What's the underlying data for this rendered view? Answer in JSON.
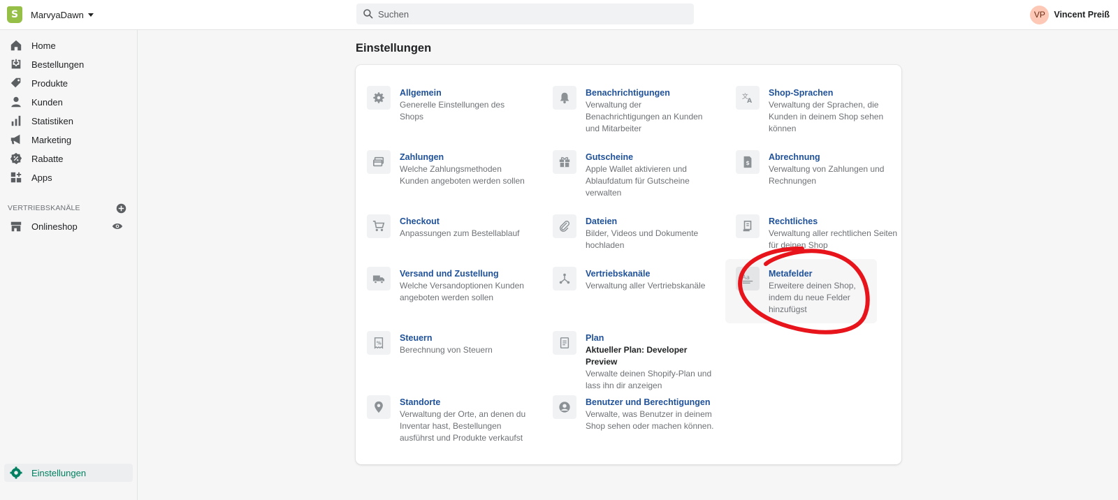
{
  "topbar": {
    "store_name": "MarvyaDawn",
    "search_placeholder": "Suchen",
    "user_initials": "VP",
    "user_name": "Vincent Preiß"
  },
  "sidebar": {
    "items": [
      {
        "label": "Home",
        "icon": "home-icon"
      },
      {
        "label": "Bestellungen",
        "icon": "orders-icon"
      },
      {
        "label": "Produkte",
        "icon": "tag-icon"
      },
      {
        "label": "Kunden",
        "icon": "person-icon"
      },
      {
        "label": "Statistiken",
        "icon": "bar-chart-icon"
      },
      {
        "label": "Marketing",
        "icon": "megaphone-icon"
      },
      {
        "label": "Rabatte",
        "icon": "discount-icon"
      },
      {
        "label": "Apps",
        "icon": "apps-icon"
      }
    ],
    "sales_channels_label": "VERTRIEBSKANÄLE",
    "onlineshop_label": "Onlineshop",
    "settings_label": "Einstellungen"
  },
  "page": {
    "title": "Einstellungen"
  },
  "settings": [
    {
      "title": "Allgemein",
      "desc": "Generelle Einstellungen des Shops",
      "icon": "gear-icon"
    },
    {
      "title": "Benachrichtigungen",
      "desc": "Verwaltung der Benachrichtigungen an Kunden und Mitarbeiter",
      "icon": "bell-icon"
    },
    {
      "title": "Shop-Sprachen",
      "desc": "Verwaltung der Sprachen, die Kunden in deinem Shop sehen können",
      "icon": "translate-icon"
    },
    {
      "title": "Zahlungen",
      "desc": "Welche Zahlungsmethoden Kunden angeboten werden sollen",
      "icon": "payment-icon"
    },
    {
      "title": "Gutscheine",
      "desc": "Apple Wallet aktivieren und Ablaufdatum für Gutscheine verwalten",
      "icon": "gift-icon"
    },
    {
      "title": "Abrechnung",
      "desc": "Verwaltung von Zahlungen und Rechnungen",
      "icon": "billing-icon"
    },
    {
      "title": "Checkout",
      "desc": "Anpassungen zum Bestellablauf",
      "icon": "cart-icon"
    },
    {
      "title": "Dateien",
      "desc": "Bilder, Videos und Dokumente hochladen",
      "icon": "paperclip-icon"
    },
    {
      "title": "Rechtliches",
      "desc": "Verwaltung aller rechtlichen Seiten für deinen Shop",
      "icon": "legal-icon"
    },
    {
      "title": "Versand und Zustellung",
      "desc": "Welche Versandoptionen Kunden angeboten werden sollen",
      "icon": "truck-icon"
    },
    {
      "title": "Vertriebskanäle",
      "desc": "Verwaltung aller Vertriebskanäle",
      "icon": "channels-icon"
    },
    {
      "title": "Metafelder",
      "desc": "Erweitere deinen Shop, indem du neue Felder hinzufügst",
      "icon": "metafields-icon"
    },
    {
      "title": "Steuern",
      "desc": "Berechnung von Steuern",
      "icon": "tax-icon"
    },
    {
      "title": "Plan",
      "subtitle": "Aktueller Plan: Developer Preview",
      "desc": "Verwalte deinen Shopify-Plan und lass ihn dir anzeigen",
      "icon": "plan-icon"
    },
    {
      "title": "Standorte",
      "desc": "Verwaltung der Orte, an denen du Inventar hast, Bestellungen ausführst und Produkte verkaufst",
      "icon": "location-icon"
    },
    {
      "title": "Benutzer und Berechtigungen",
      "desc": "Verwalte, was Benutzer in deinem Shop sehen oder machen können.",
      "icon": "user-circle-icon"
    }
  ],
  "colors": {
    "link": "#1f5199",
    "active_nav": "#008060",
    "annotation": "#e8141b",
    "logo": "#95bf47"
  }
}
